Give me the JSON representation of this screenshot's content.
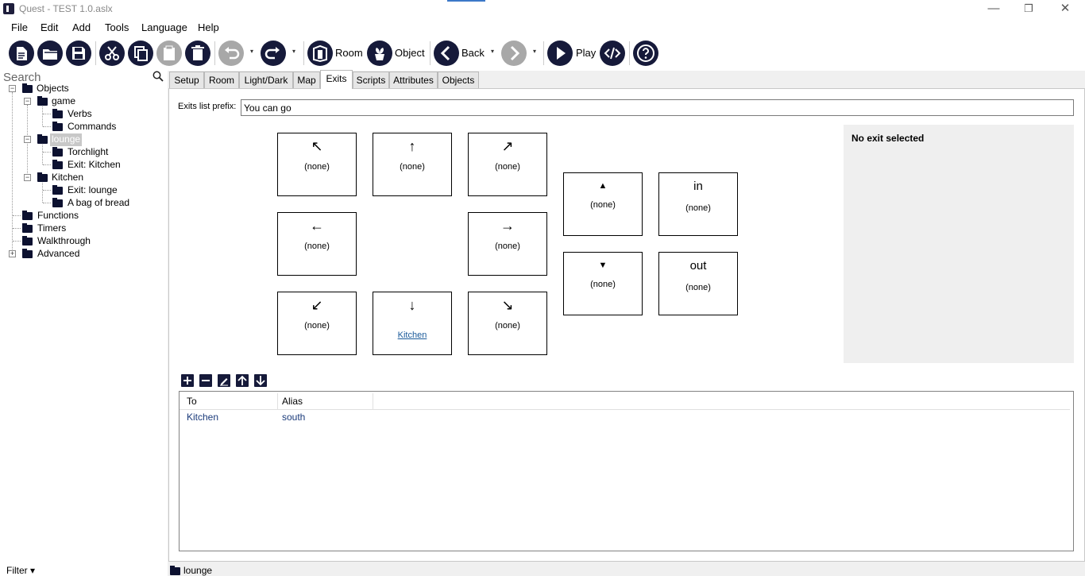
{
  "window": {
    "title": "Quest - TEST 1.0.aslx",
    "minimize": "—",
    "maximize": "❐",
    "close": "✕"
  },
  "menu": [
    "File",
    "Edit",
    "Add",
    "Tools",
    "Language",
    "Help"
  ],
  "toolbar": {
    "room_label": "Room",
    "object_label": "Object",
    "back_label": "Back",
    "play_label": "Play",
    "icons": [
      "new-file",
      "open-folder",
      "save",
      "cut",
      "copy",
      "paste",
      "delete",
      "undo",
      "redo",
      "room",
      "object",
      "back",
      "forward",
      "play",
      "code-view",
      "help"
    ]
  },
  "search": {
    "label": "Search"
  },
  "tree": {
    "objects": "Objects",
    "game": "game",
    "verbs": "Verbs",
    "commands": "Commands",
    "lounge": "lounge",
    "torchlight": "Torchlight",
    "exit_kitchen": "Exit: Kitchen",
    "kitchen": "Kitchen",
    "exit_lounge": "Exit: lounge",
    "bag_of_bread": "A bag of bread",
    "functions": "Functions",
    "timers": "Timers",
    "walkthrough": "Walkthrough",
    "advanced": "Advanced"
  },
  "filter": "Filter ▾",
  "tabs": [
    "Setup",
    "Room",
    "Light/Dark",
    "Map",
    "Exits",
    "Scripts",
    "Attributes",
    "Objects"
  ],
  "exits": {
    "prefix_label": "Exits list prefix:",
    "prefix_value": "You can go",
    "northwest": {
      "arrow": "↖",
      "value": "(none)"
    },
    "north": {
      "arrow": "↑",
      "value": "(none)"
    },
    "northeast": {
      "arrow": "↗",
      "value": "(none)"
    },
    "west": {
      "arrow": "←",
      "value": "(none)"
    },
    "east": {
      "arrow": "→",
      "value": "(none)"
    },
    "southwest": {
      "arrow": "↙",
      "value": "(none)"
    },
    "south": {
      "arrow": "↓",
      "value": "Kitchen"
    },
    "southeast": {
      "arrow": "↘",
      "value": "(none)"
    },
    "up": {
      "arrow": "▲",
      "value": "(none)"
    },
    "down": {
      "arrow": "▼",
      "value": "(none)"
    },
    "in": {
      "word": "in",
      "value": "(none)"
    },
    "out": {
      "word": "out",
      "value": "(none)"
    },
    "detail": "No exit selected"
  },
  "list": {
    "col_to": "To",
    "col_alias": "Alias",
    "rows": [
      {
        "to": "Kitchen",
        "alias": "south"
      }
    ]
  },
  "status": {
    "current": "lounge"
  },
  "colors": {
    "icon_dark": "#161a3a",
    "link": "#1a5a9a",
    "selection": "#c8c8c8"
  }
}
